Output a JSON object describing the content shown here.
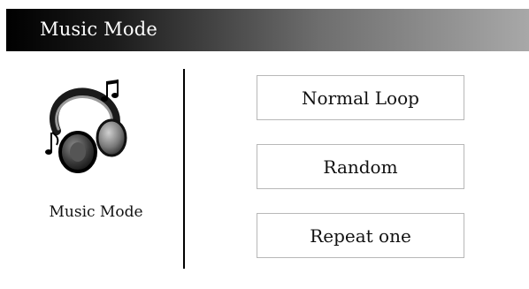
{
  "window": {
    "title": "Music Mode"
  },
  "sidebar": {
    "icon": "headphones-icon",
    "label": "Music Mode"
  },
  "modes": [
    {
      "label": "Normal Loop"
    },
    {
      "label": "Random"
    },
    {
      "label": "Repeat one"
    }
  ],
  "colors": {
    "titlebar_start": "#000000",
    "titlebar_end": "#a8a8a8",
    "button_border": "#b8b8b8"
  }
}
